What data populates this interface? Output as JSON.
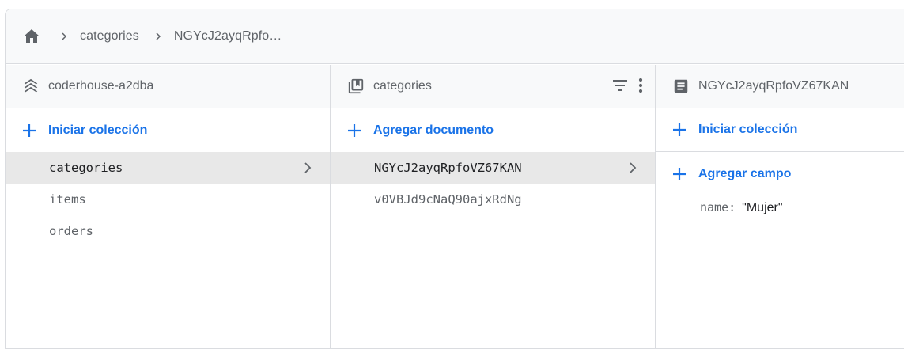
{
  "colors": {
    "accent": "#1a73e8",
    "muted": "#5f6368",
    "selected_bg": "#e8e8e8"
  },
  "breadcrumb": {
    "home_icon": "home-icon",
    "items": [
      {
        "label": "categories"
      },
      {
        "label": "NGYcJ2ayqRpfo…"
      }
    ]
  },
  "columns": {
    "root": {
      "header_icon": "database-layers-icon",
      "title": "coderhouse-a2dba",
      "action_label": "Iniciar colección",
      "items": [
        {
          "label": "categories",
          "selected": true
        },
        {
          "label": "items",
          "selected": false
        },
        {
          "label": "orders",
          "selected": false
        }
      ]
    },
    "collection": {
      "header_icon": "collection-icon",
      "title": "categories",
      "action_label": "Agregar documento",
      "items": [
        {
          "label": "NGYcJ2ayqRpfoVZ67KAN",
          "selected": true
        },
        {
          "label": "v0VBJd9cNaQ90ajxRdNg",
          "selected": false
        }
      ]
    },
    "document": {
      "header_icon": "document-icon",
      "title": "NGYcJ2ayqRpfoVZ67KAN",
      "start_collection_label": "Iniciar colección",
      "add_field_label": "Agregar campo",
      "fields": [
        {
          "key": "name",
          "value": "\"Mujer\""
        }
      ]
    }
  }
}
